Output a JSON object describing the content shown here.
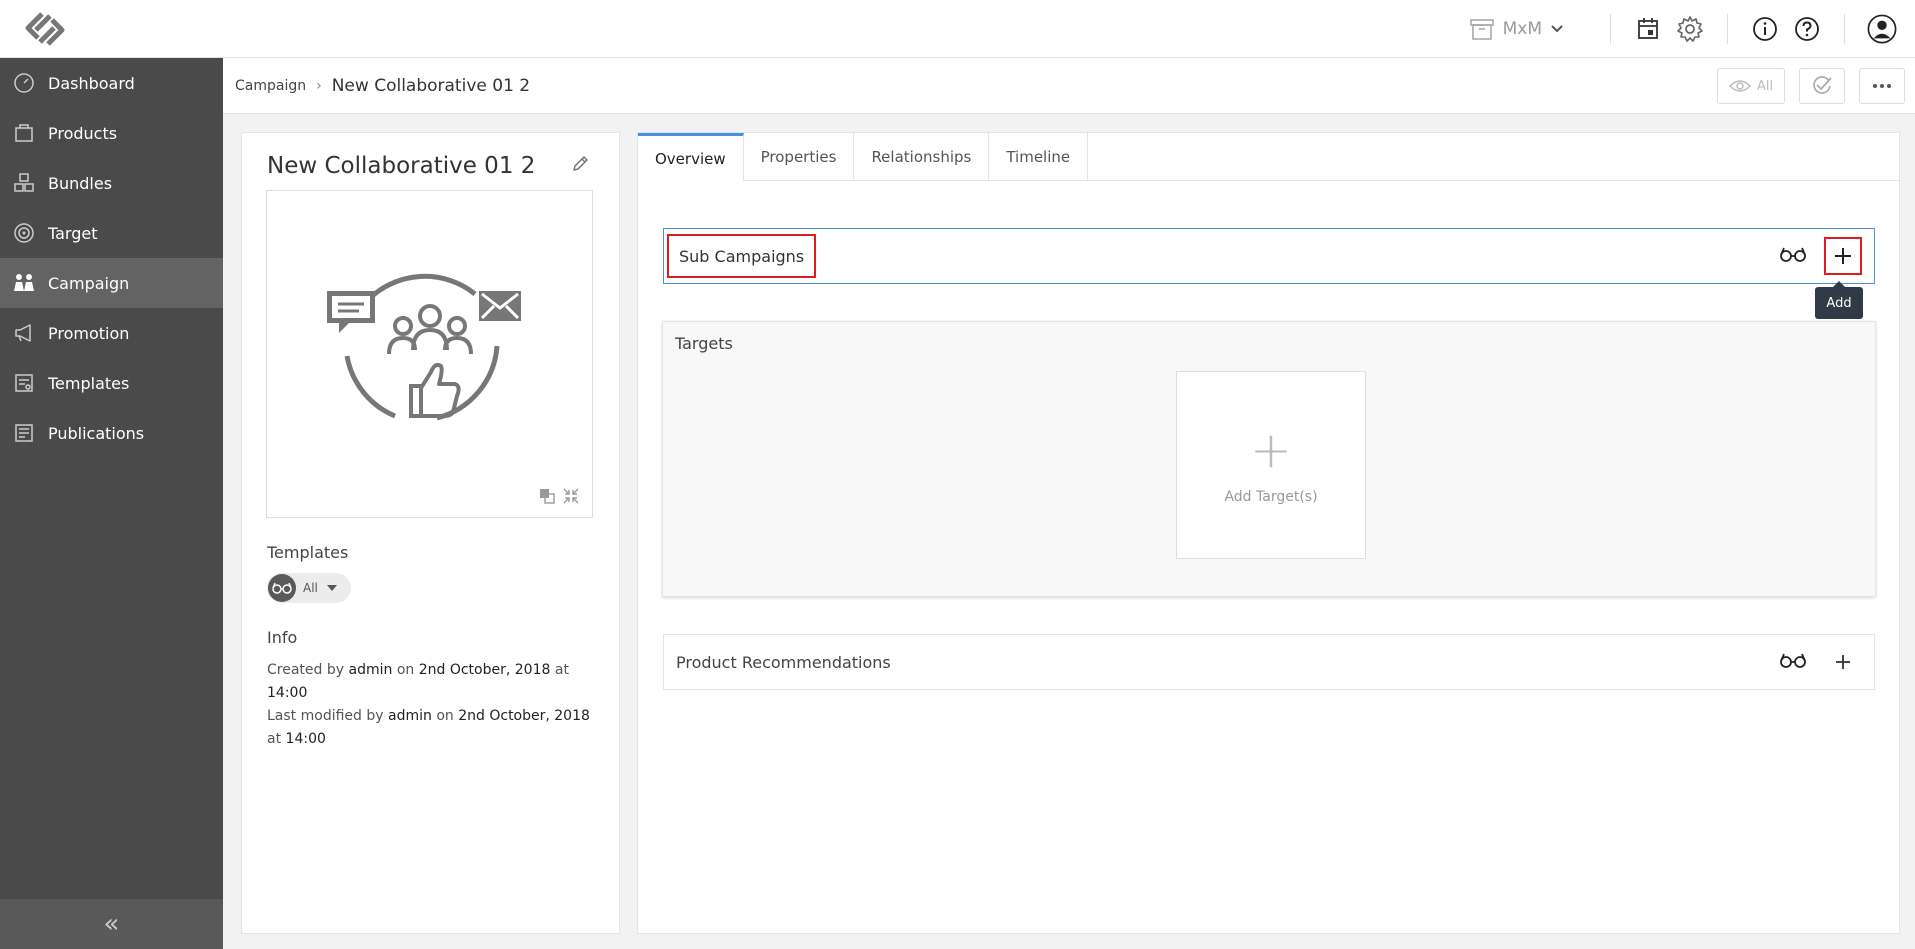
{
  "topbar": {
    "workspace_label": "MxM"
  },
  "sidebar": {
    "items": [
      {
        "label": "Dashboard",
        "icon": "dashboard-icon"
      },
      {
        "label": "Products",
        "icon": "products-icon"
      },
      {
        "label": "Bundles",
        "icon": "bundles-icon"
      },
      {
        "label": "Target",
        "icon": "target-icon"
      },
      {
        "label": "Campaign",
        "icon": "campaign-icon",
        "active": true
      },
      {
        "label": "Promotion",
        "icon": "megaphone-icon"
      },
      {
        "label": "Templates",
        "icon": "templates-icon"
      },
      {
        "label": "Publications",
        "icon": "publications-icon"
      }
    ],
    "collapse_glyph": "«"
  },
  "breadcrumb": {
    "root": "Campaign",
    "separator": "›",
    "current": "New Collaborative 01 2",
    "view_filter_label": "All"
  },
  "left_panel": {
    "title": "New Collaborative 01 2",
    "templates_label": "Templates",
    "templates_filter": "All",
    "info_label": "Info",
    "info": {
      "created_prefix": "Created by",
      "created_by": "admin",
      "on_1": "on",
      "created_date": "2nd October, 2018",
      "at_1": "at",
      "created_time": "14:00",
      "modified_prefix": "Last modified by",
      "modified_by": "admin",
      "on_2": "on",
      "modified_date": "2nd October, 2018",
      "at_2": "at",
      "modified_time": "14:00"
    }
  },
  "tabs": [
    {
      "label": "Overview",
      "active": true
    },
    {
      "label": "Properties"
    },
    {
      "label": "Relationships"
    },
    {
      "label": "Timeline"
    }
  ],
  "sections": {
    "sub_campaigns": {
      "title": "Sub Campaigns",
      "tooltip": "Add"
    },
    "targets": {
      "title": "Targets",
      "add_label": "Add Target(s)",
      "add_glyph": "+"
    },
    "product_recommendations": {
      "title": "Product Recommendations"
    }
  },
  "colors": {
    "sidebar_bg": "#4a4a4a",
    "sidebar_active": "#636363",
    "accent_blue": "#4a90e2",
    "highlight_red": "#e01b24",
    "tooltip_bg": "#2f3a46"
  }
}
